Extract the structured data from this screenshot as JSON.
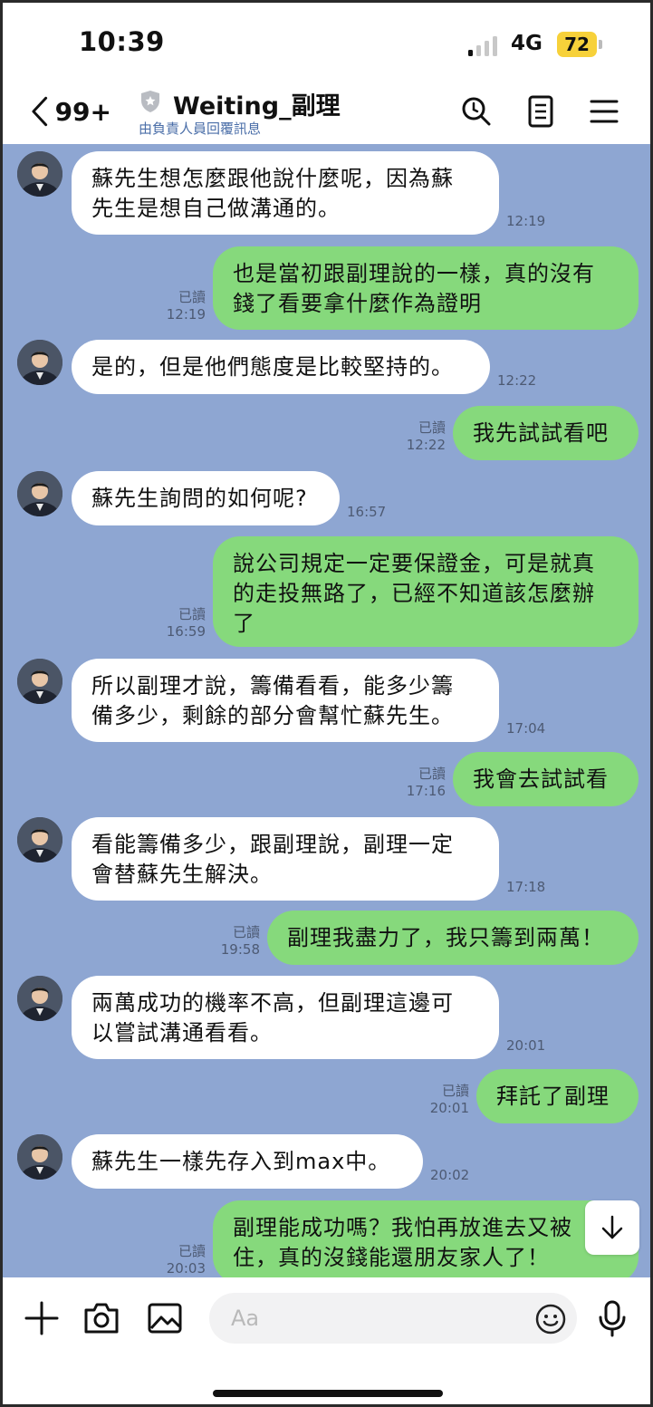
{
  "status_bar": {
    "time": "10:39",
    "network": "4G",
    "battery": "72"
  },
  "header": {
    "back_count": "99+",
    "title": "Weiting_副理",
    "subtitle": "由負責人員回覆訊息"
  },
  "messages": [
    {
      "side": "in",
      "lines": [
        "蘇先生想怎麼跟他說什麼呢，因為蘇",
        "先生是想自己做溝通的。"
      ],
      "time": "12:19"
    },
    {
      "side": "out",
      "lines": [
        "也是當初跟副理說的一樣，真的沒有",
        "錢了看要拿什麼作為證明"
      ],
      "read": "已讀",
      "time": "12:19"
    },
    {
      "side": "in",
      "lines": [
        "是的，但是他們態度是比較堅持的。"
      ],
      "time": "12:22"
    },
    {
      "side": "out",
      "lines": [
        "我先試試看吧"
      ],
      "read": "已讀",
      "time": "12:22"
    },
    {
      "side": "in",
      "lines": [
        "蘇先生詢問的如何呢?"
      ],
      "time": "16:57"
    },
    {
      "side": "out",
      "lines": [
        "說公司規定一定要保證金，可是就真",
        "的走投無路了，已經不知道該怎麼辦",
        "了"
      ],
      "read": "已讀",
      "time": "16:59"
    },
    {
      "side": "in",
      "lines": [
        "所以副理才說，籌備看看，能多少籌",
        "備多少，剩餘的部分會幫忙蘇先生。"
      ],
      "time": "17:04"
    },
    {
      "side": "out",
      "lines": [
        "我會去試試看"
      ],
      "read": "已讀",
      "time": "17:16"
    },
    {
      "side": "in",
      "lines": [
        "看能籌備多少，跟副理說，副理一定",
        "會替蘇先生解決。"
      ],
      "time": "17:18"
    },
    {
      "side": "out",
      "lines": [
        "副理我盡力了，我只籌到兩萬！"
      ],
      "read": "已讀",
      "time": "19:58"
    },
    {
      "side": "in",
      "lines": [
        "兩萬成功的機率不高，但副理這邊可",
        "以嘗試溝通看看。"
      ],
      "time": "20:01"
    },
    {
      "side": "out",
      "lines": [
        "拜託了副理"
      ],
      "read": "已讀",
      "time": "20:01"
    },
    {
      "side": "in",
      "lines": [
        "蘇先生一樣先存入到max中。"
      ],
      "time": "20:02"
    },
    {
      "side": "out",
      "lines": [
        "副理能成功嗎？我怕再放進去又被",
        "住，真的沒錢能還朋友家人了！"
      ],
      "read": "已讀",
      "time": "20:03"
    }
  ],
  "input": {
    "placeholder": "Aa"
  },
  "icons": {
    "header": [
      "chevron-left-icon",
      "shield-icon",
      "search-icon",
      "notes-icon",
      "menu-icon"
    ],
    "inputbar": [
      "plus-icon",
      "camera-icon",
      "image-icon",
      "emoji-icon",
      "microphone-icon"
    ],
    "scroll": "arrow-down-icon"
  },
  "colors": {
    "chat_background": "#8ea6d2",
    "incoming_bubble": "#ffffff",
    "outgoing_bubble": "#86d97c",
    "battery": "#f7d13a",
    "subtitle": "#4a6ea8"
  }
}
